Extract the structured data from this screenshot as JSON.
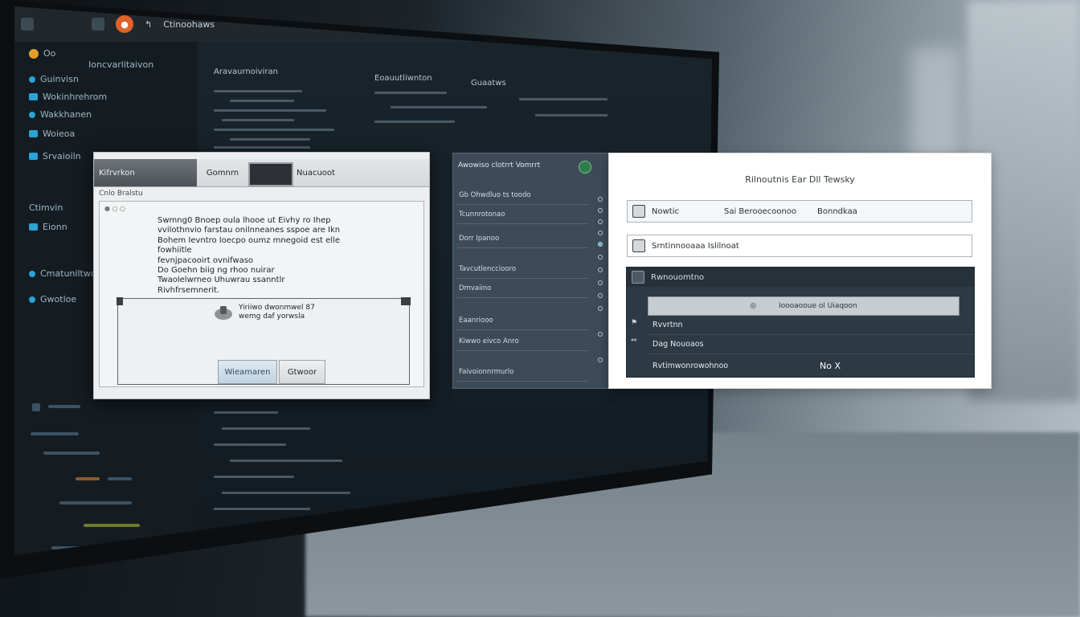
{
  "titlebar": {
    "label": "Ctinoohaws"
  },
  "sidebar": {
    "badge": "Oo",
    "items": [
      "Ioncvarlitaivon",
      "Guinvisn",
      "Wokinhrehrom",
      "Wakkhanen",
      "Woieoa",
      "Srvaioiln",
      "Ctimvin",
      "Eionn",
      "Cmatuniltwo",
      "Gwotloe"
    ]
  },
  "editor": {
    "headers": [
      "Aravaurnoiviran",
      "Eoauutliwnton",
      "Guaatws"
    ]
  },
  "dialog": {
    "tab_active": "Kifrvrkon",
    "tab_second": "Gomnrn",
    "tab_third": "Nuacuoot",
    "subtitle": "Cnlo Bralstu",
    "message": "Swmng0 Bnoep oula lhooe ut Eivhy ro Ihep\nvvilothnvio farstau onilnneanes sspoe are Ikn\nBohem Ievntro loecpo oumz mnegoid est elle fowhiitle\nfevnjpacooirt ovnifwaso\nDo Goehn biig ng rhoo nuirar\nTwaolelwrneo Uhuwrau ssanntlr\nRivhfrsemnerit.",
    "inner_message": "Yiriiwo dwonmwel 87\nwemg daf yorwsla",
    "ok_label": "Wieamaren",
    "cancel_label": "Gtwoor"
  },
  "listpanel": {
    "header": "Awowiso clotrrt Vomrrt",
    "rows": [
      "Gb Ohwdluo ts toodo",
      "Tcunnrotonao",
      "Dorr Ipanoo",
      "Tavcutlencciooro",
      "Dmvaiino",
      "Eaanriooo",
      "Kiwwo eivco Anro",
      "Faivoionnrmurlo"
    ]
  },
  "formpanel": {
    "title": "Rilnoutnis Ear Dll Tewsky",
    "field1_label": "Nowtic",
    "field1_mid": "Sai Berooecoonoo",
    "field1_right": "Bonndkaa",
    "field2_value": "Srntinnooaaa Islilnoat",
    "table_header": "Rwnouomtno",
    "table_search": "Ioooaooue ol Uiaqoon",
    "rows": [
      "Rvvrtnn",
      "Dag Nouoaos",
      "Rvtimwonrowohnoo"
    ],
    "row3_action": "No X"
  }
}
